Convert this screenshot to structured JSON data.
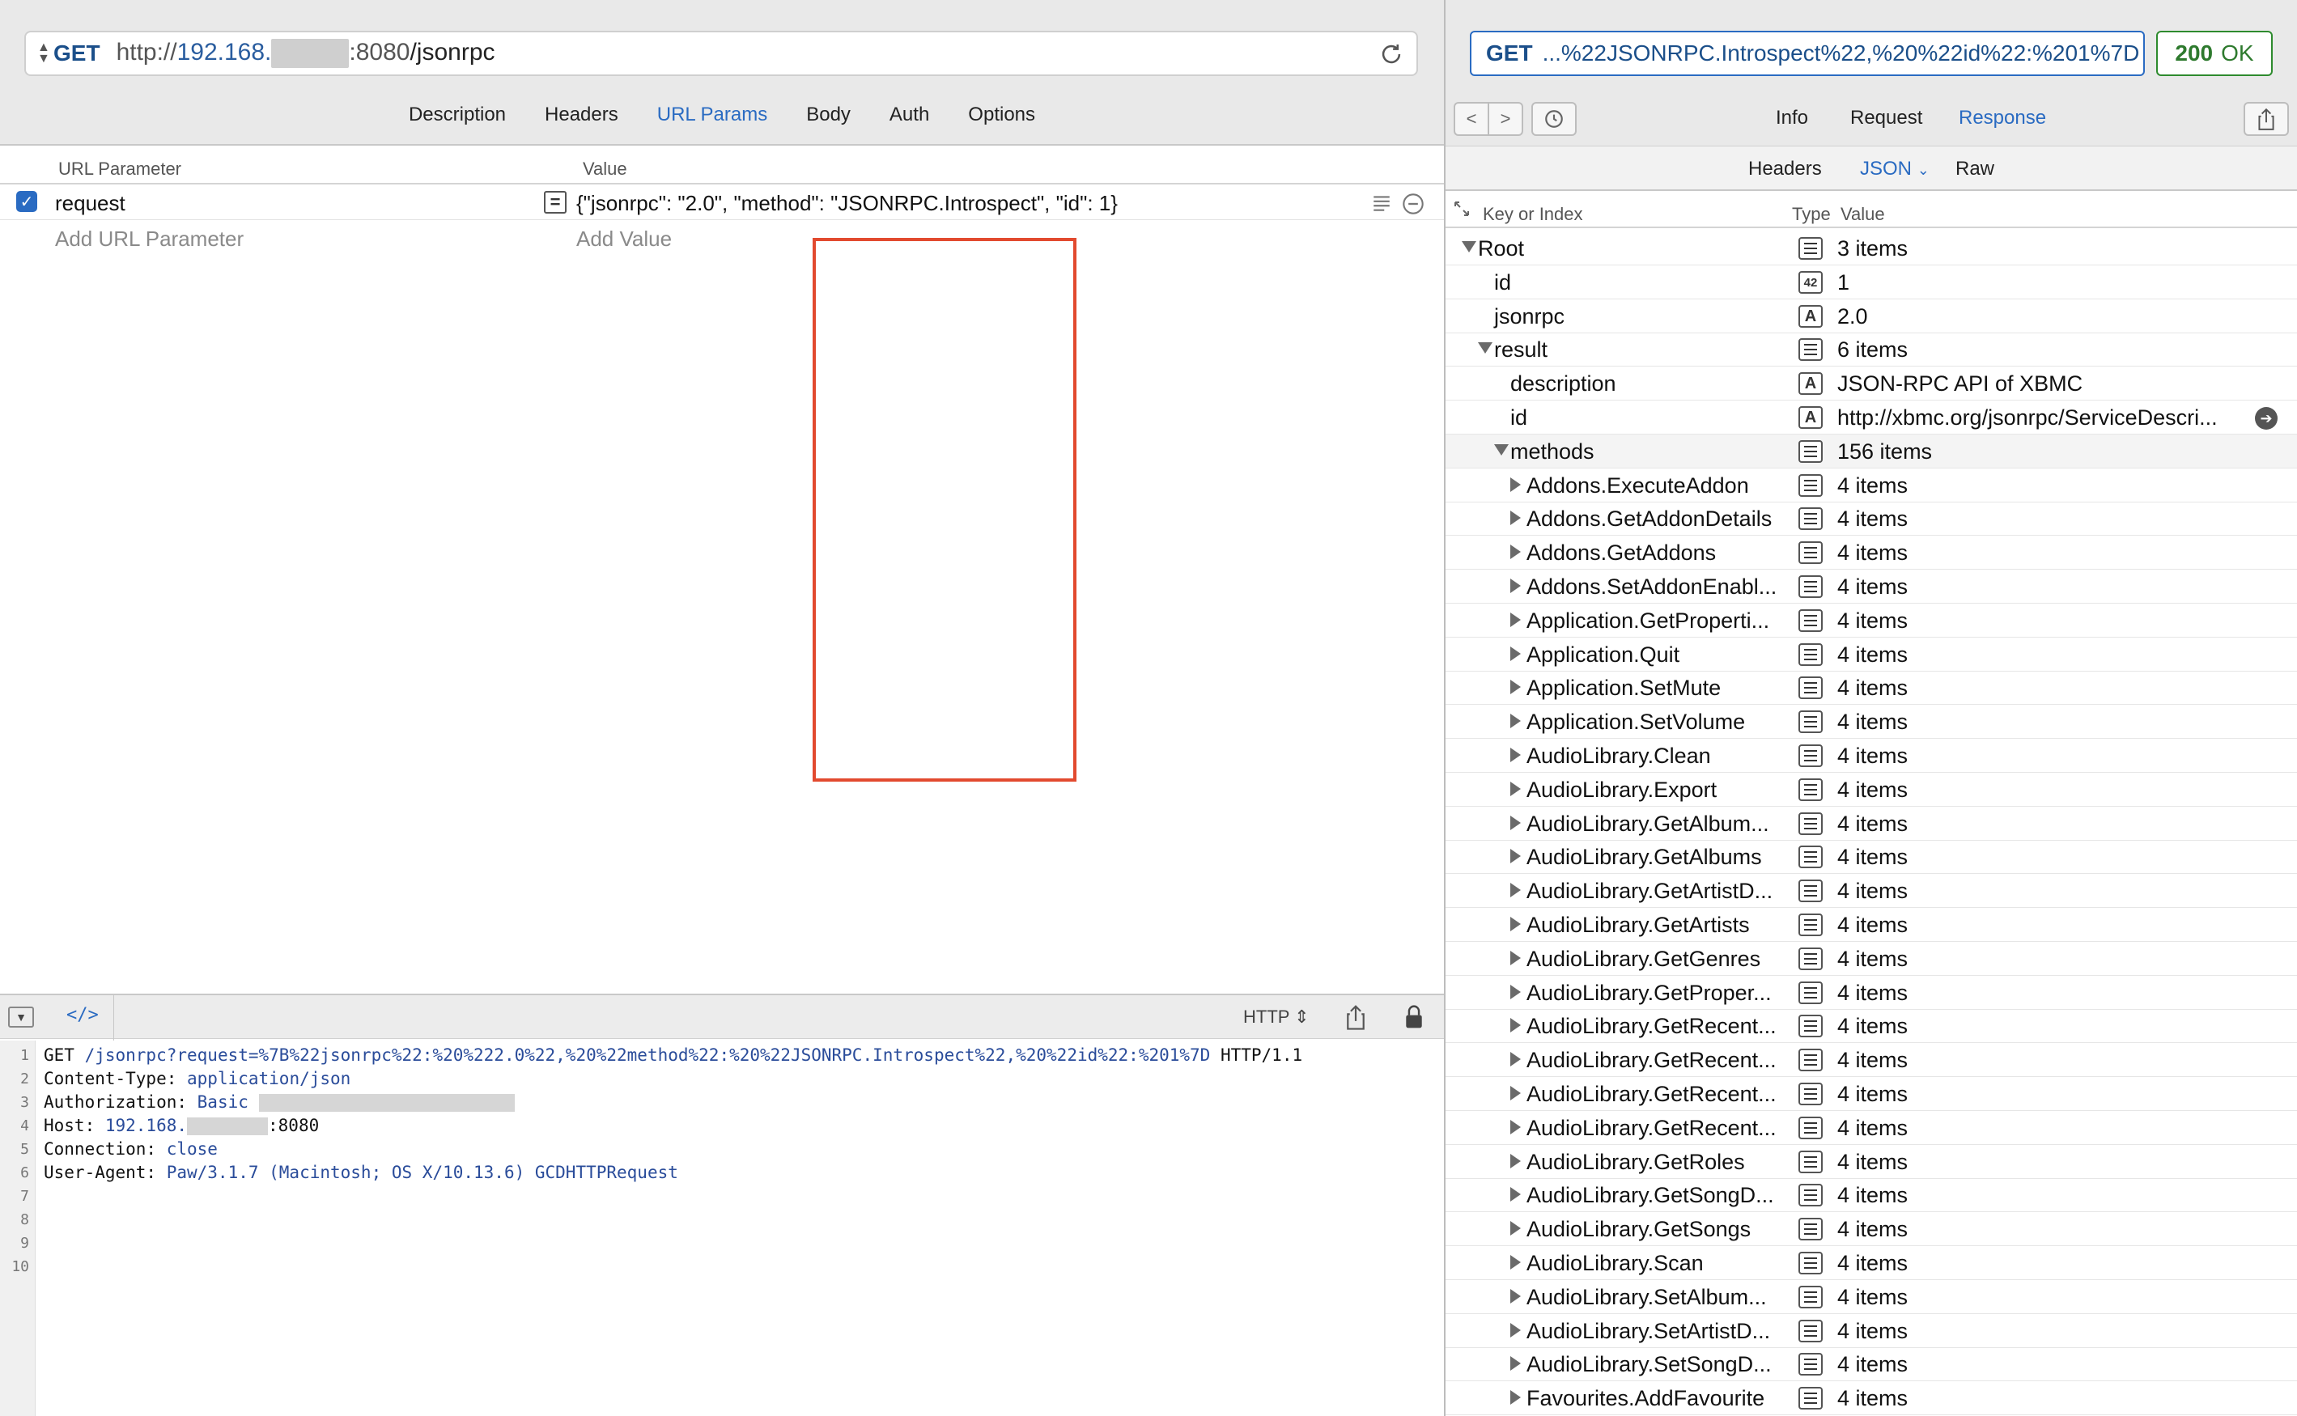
{
  "request": {
    "method": "GET",
    "url_prefix": "http://",
    "url_host": "192.168.",
    "url_port_path": ":8080",
    "url_path": "/jsonrpc"
  },
  "request_tabs": [
    "Description",
    "Headers",
    "URL Params",
    "Body",
    "Auth",
    "Options"
  ],
  "active_request_tab": "URL Params",
  "params": {
    "col_name": "URL Parameter",
    "col_value": "Value",
    "row_name": "request",
    "row_value": "{\"jsonrpc\": \"2.0\", \"method\": \"JSONRPC.Introspect\", \"id\": 1}",
    "add_name_placeholder": "Add URL Parameter",
    "add_value_placeholder": "Add Value"
  },
  "code_toolbar": {
    "toggle_label": "</>",
    "format": "HTTP"
  },
  "code_lines": [
    {
      "n": "1",
      "k": "GET ",
      "v": "/jsonrpc?request=%7B%22jsonrpc%22:%20%222.0%22,%20%22method%22:%20%22JSONRPC.Introspect%22,%20%22id%22:%201%7D",
      "s": " HTTP/1.1"
    },
    {
      "n": "2",
      "k": "Content-Type: ",
      "v": "application/json",
      "s": ""
    },
    {
      "n": "3",
      "k": "Authorization: ",
      "v": "Basic ",
      "s": ""
    },
    {
      "n": "4",
      "k": "Host: ",
      "v": "192.168.",
      "s": ":8080"
    },
    {
      "n": "5",
      "k": "Connection: ",
      "v": "close",
      "s": ""
    },
    {
      "n": "6",
      "k": "User-Agent: ",
      "v": "Paw/3.1.7 (Macintosh; OS X/10.13.6) GCDHTTPRequest",
      "s": ""
    },
    {
      "n": "7",
      "k": "",
      "v": "",
      "s": ""
    },
    {
      "n": "8",
      "k": "",
      "v": "",
      "s": ""
    },
    {
      "n": "9",
      "k": "",
      "v": "",
      "s": ""
    },
    {
      "n": "10",
      "k": "",
      "v": "",
      "s": ""
    }
  ],
  "response": {
    "summary_method": "GET",
    "summary_url": "...%22JSONRPC.Introspect%22,%20%22id%22:%201%7D",
    "status_code": "200",
    "status_text": "OK",
    "tabs": [
      "Info",
      "Request",
      "Response"
    ],
    "active_tab": "Response",
    "view_tabs": [
      "Headers",
      "JSON",
      "Raw"
    ],
    "active_view": "JSON"
  },
  "tree_header": {
    "key": "Key or Index",
    "type": "Type",
    "value": "Value"
  },
  "tree_rows": [
    {
      "key": "Root",
      "depth": 0,
      "expander": "down",
      "type": "list",
      "value": "3 items"
    },
    {
      "key": "id",
      "depth": 1,
      "expander": "none",
      "type": "number",
      "value": "1"
    },
    {
      "key": "jsonrpc",
      "depth": 1,
      "expander": "none",
      "type": "string",
      "value": "2.0"
    },
    {
      "key": "result",
      "depth": 1,
      "expander": "down",
      "type": "list",
      "value": "6 items"
    },
    {
      "key": "description",
      "depth": 2,
      "expander": "none",
      "type": "string",
      "value": "JSON-RPC API of XBMC"
    },
    {
      "key": "id",
      "depth": 2,
      "expander": "none",
      "type": "string",
      "value": "http://xbmc.org/jsonrpc/ServiceDescri...",
      "goto": true
    },
    {
      "key": "methods",
      "depth": 2,
      "expander": "down",
      "type": "list",
      "value": "156 items"
    },
    {
      "key": "Addons.ExecuteAddon",
      "depth": 3,
      "expander": "right",
      "type": "list",
      "value": "4 items"
    },
    {
      "key": "Addons.GetAddonDetails",
      "depth": 3,
      "expander": "right",
      "type": "list",
      "value": "4 items"
    },
    {
      "key": "Addons.GetAddons",
      "depth": 3,
      "expander": "right",
      "type": "list",
      "value": "4 items"
    },
    {
      "key": "Addons.SetAddonEnabl...",
      "depth": 3,
      "expander": "right",
      "type": "list",
      "value": "4 items"
    },
    {
      "key": "Application.GetProperti...",
      "depth": 3,
      "expander": "right",
      "type": "list",
      "value": "4 items"
    },
    {
      "key": "Application.Quit",
      "depth": 3,
      "expander": "right",
      "type": "list",
      "value": "4 items"
    },
    {
      "key": "Application.SetMute",
      "depth": 3,
      "expander": "right",
      "type": "list",
      "value": "4 items"
    },
    {
      "key": "Application.SetVolume",
      "depth": 3,
      "expander": "right",
      "type": "list",
      "value": "4 items"
    },
    {
      "key": "AudioLibrary.Clean",
      "depth": 3,
      "expander": "right",
      "type": "list",
      "value": "4 items"
    },
    {
      "key": "AudioLibrary.Export",
      "depth": 3,
      "expander": "right",
      "type": "list",
      "value": "4 items"
    },
    {
      "key": "AudioLibrary.GetAlbum...",
      "depth": 3,
      "expander": "right",
      "type": "list",
      "value": "4 items"
    },
    {
      "key": "AudioLibrary.GetAlbums",
      "depth": 3,
      "expander": "right",
      "type": "list",
      "value": "4 items"
    },
    {
      "key": "AudioLibrary.GetArtistD...",
      "depth": 3,
      "expander": "right",
      "type": "list",
      "value": "4 items"
    },
    {
      "key": "AudioLibrary.GetArtists",
      "depth": 3,
      "expander": "right",
      "type": "list",
      "value": "4 items"
    },
    {
      "key": "AudioLibrary.GetGenres",
      "depth": 3,
      "expander": "right",
      "type": "list",
      "value": "4 items"
    },
    {
      "key": "AudioLibrary.GetProper...",
      "depth": 3,
      "expander": "right",
      "type": "list",
      "value": "4 items"
    },
    {
      "key": "AudioLibrary.GetRecent...",
      "depth": 3,
      "expander": "right",
      "type": "list",
      "value": "4 items"
    },
    {
      "key": "AudioLibrary.GetRecent...",
      "depth": 3,
      "expander": "right",
      "type": "list",
      "value": "4 items"
    },
    {
      "key": "AudioLibrary.GetRecent...",
      "depth": 3,
      "expander": "right",
      "type": "list",
      "value": "4 items"
    },
    {
      "key": "AudioLibrary.GetRecent...",
      "depth": 3,
      "expander": "right",
      "type": "list",
      "value": "4 items"
    },
    {
      "key": "AudioLibrary.GetRoles",
      "depth": 3,
      "expander": "right",
      "type": "list",
      "value": "4 items"
    },
    {
      "key": "AudioLibrary.GetSongD...",
      "depth": 3,
      "expander": "right",
      "type": "list",
      "value": "4 items"
    },
    {
      "key": "AudioLibrary.GetSongs",
      "depth": 3,
      "expander": "right",
      "type": "list",
      "value": "4 items"
    },
    {
      "key": "AudioLibrary.Scan",
      "depth": 3,
      "expander": "right",
      "type": "list",
      "value": "4 items"
    },
    {
      "key": "AudioLibrary.SetAlbum...",
      "depth": 3,
      "expander": "right",
      "type": "list",
      "value": "4 items"
    },
    {
      "key": "AudioLibrary.SetArtistD...",
      "depth": 3,
      "expander": "right",
      "type": "list",
      "value": "4 items"
    },
    {
      "key": "AudioLibrary.SetSongD...",
      "depth": 3,
      "expander": "right",
      "type": "list",
      "value": "4 items"
    },
    {
      "key": "Favourites.AddFavourite",
      "depth": 3,
      "expander": "right",
      "type": "list",
      "value": "4 items"
    }
  ],
  "colors": {
    "accent": "#2a6bc2",
    "status_ok": "#2e7a2e",
    "highlight_box": "#e24a2f"
  }
}
